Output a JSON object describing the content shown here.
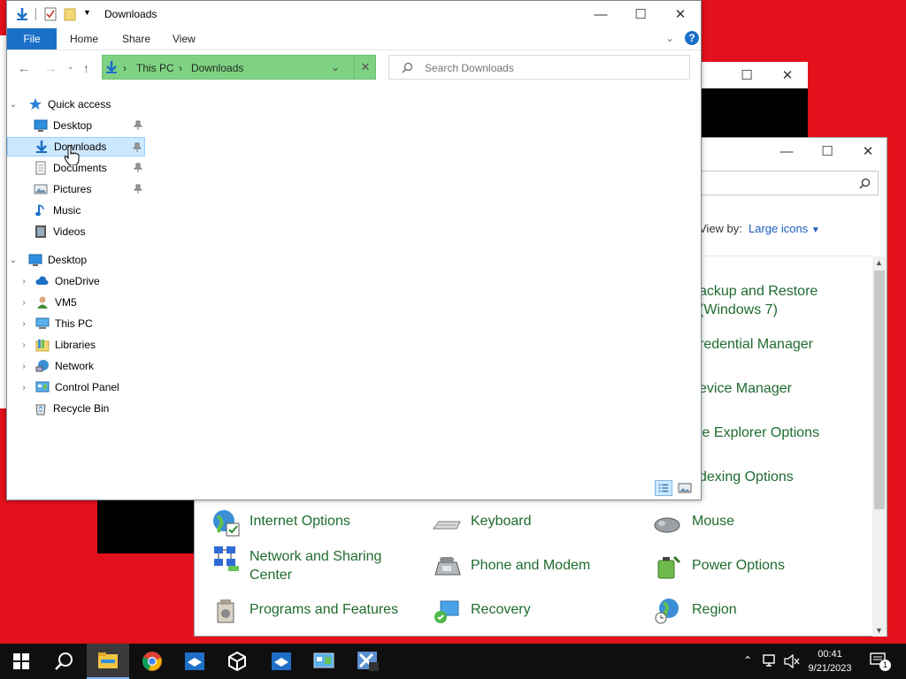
{
  "control_panel": {
    "search_icon": "search-icon",
    "view_by_label": "View by:",
    "view_by_value": "Large icons",
    "items": [
      {
        "label": "ackup and Restore\n(Windows 7)",
        "icon": "backup-icon"
      },
      {
        "label": "redential Manager",
        "icon": "credential-icon"
      },
      {
        "label": "evice Manager",
        "icon": "device-manager-icon"
      },
      {
        "label": "le Explorer Options",
        "icon": "folder-options-icon"
      },
      {
        "label": "dexing Options",
        "icon": "indexing-icon"
      },
      {
        "label": "Internet Options",
        "icon": "internet-options-icon"
      },
      {
        "label": "Keyboard",
        "icon": "keyboard-icon"
      },
      {
        "label": "Mouse",
        "icon": "mouse-icon"
      },
      {
        "label": "Network and Sharing\nCenter",
        "icon": "network-sharing-icon"
      },
      {
        "label": "Phone and Modem",
        "icon": "phone-modem-icon"
      },
      {
        "label": "Power Options",
        "icon": "power-options-icon"
      },
      {
        "label": "Programs and Features",
        "icon": "programs-icon"
      },
      {
        "label": "Recovery",
        "icon": "recovery-icon"
      },
      {
        "label": "Region",
        "icon": "region-icon"
      }
    ]
  },
  "explorer": {
    "title": "Downloads",
    "ribbon": {
      "file": "File",
      "home": "Home",
      "share": "Share",
      "view": "View"
    },
    "address": {
      "crumbs": [
        "This PC",
        "Downloads"
      ]
    },
    "search": {
      "placeholder": "Search Downloads"
    },
    "tree": {
      "quick_access": "Quick access",
      "quick_items": [
        "Desktop",
        "Downloads",
        "Documents",
        "Pictures",
        "Music",
        "Videos"
      ],
      "desktop": "Desktop",
      "desktop_items": [
        "OneDrive",
        "VM5",
        "This PC",
        "Libraries",
        "Network",
        "Control Panel",
        "Recycle Bin"
      ]
    }
  },
  "taskbar": {
    "time": "00:41",
    "date": "9/21/2023",
    "notification_count": "1"
  },
  "colors": {
    "desktop": "#e3111b",
    "accent": "#1b6fc7",
    "address_bar": "#80d283",
    "cp_link": "#1f6b2e"
  }
}
